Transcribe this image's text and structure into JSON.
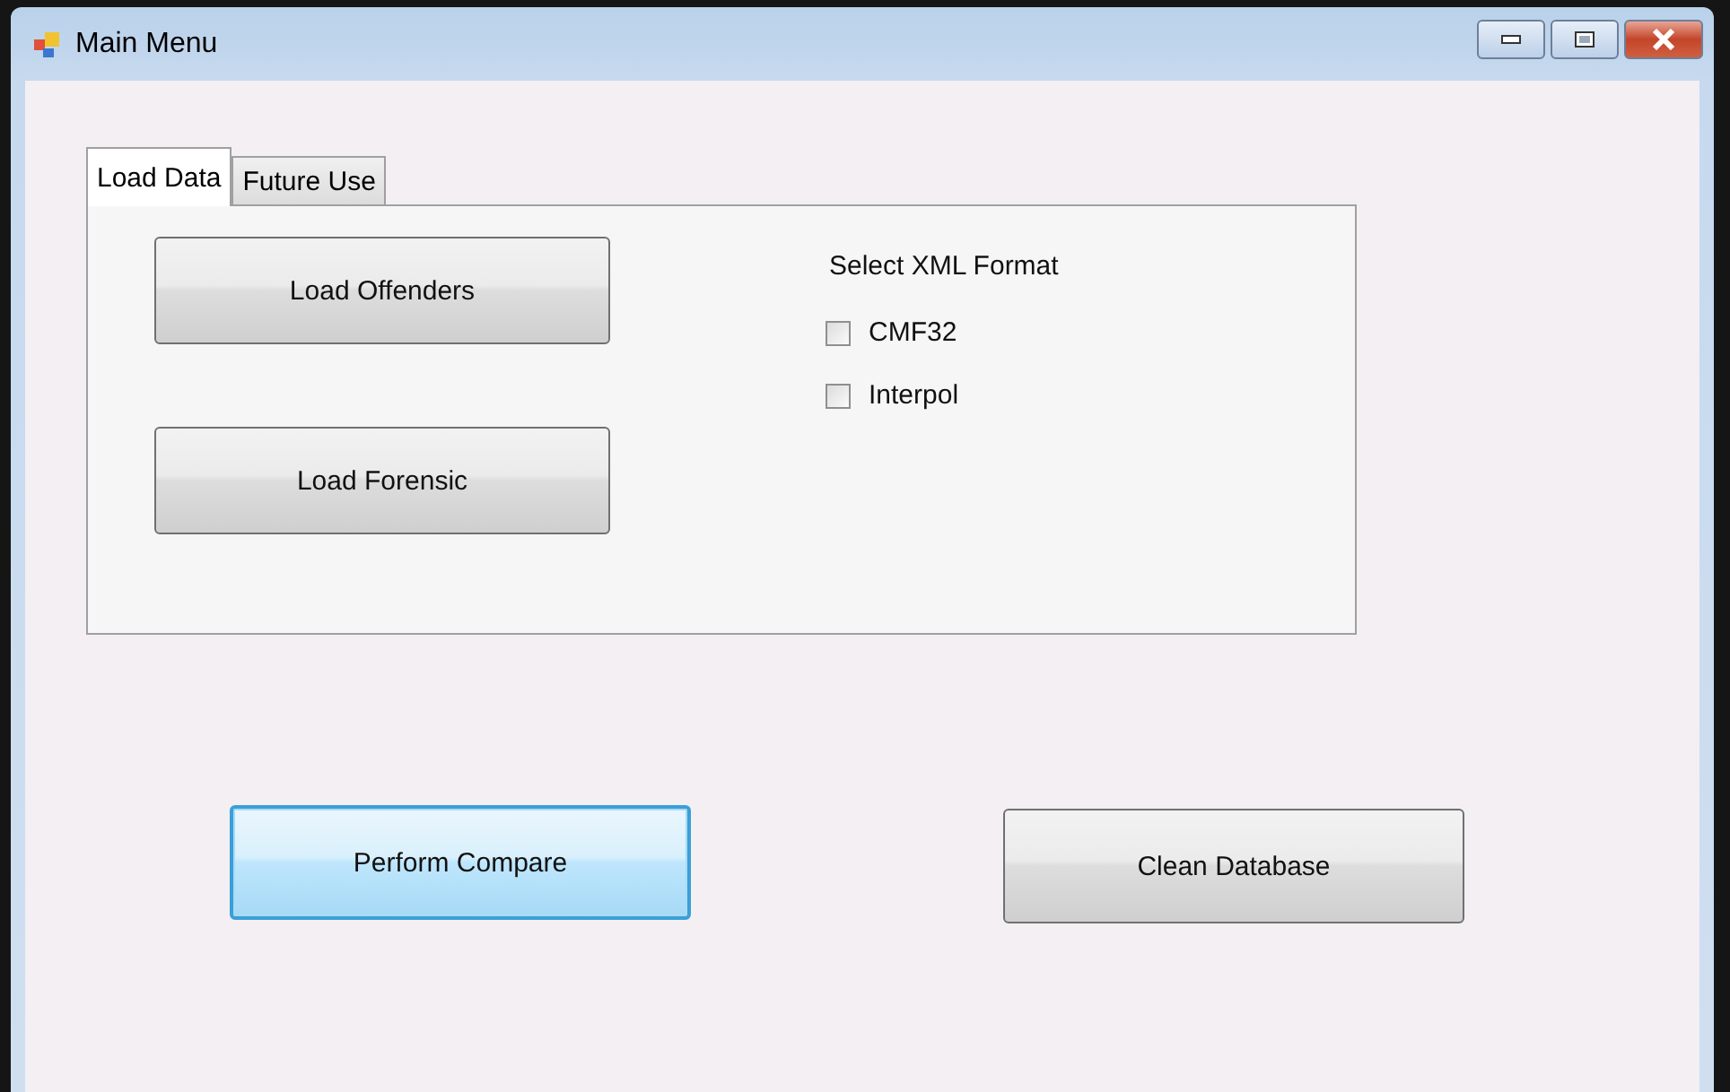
{
  "window": {
    "title": "Main Menu"
  },
  "tabs": [
    {
      "label": "Load Data",
      "selected": true
    },
    {
      "label": "Future Use",
      "selected": false
    }
  ],
  "load_buttons": [
    {
      "label": "Load Offenders",
      "focused": false
    },
    {
      "label": "Load Forensic",
      "focused": false
    }
  ],
  "xml_format": {
    "label": "Select XML Format",
    "options": [
      {
        "label": "CMF32",
        "checked": false
      },
      {
        "label": "Interpol",
        "checked": false
      }
    ]
  },
  "actions": [
    {
      "label": "Perform Compare",
      "focused": true
    },
    {
      "label": "Clean Database",
      "focused": false
    }
  ]
}
